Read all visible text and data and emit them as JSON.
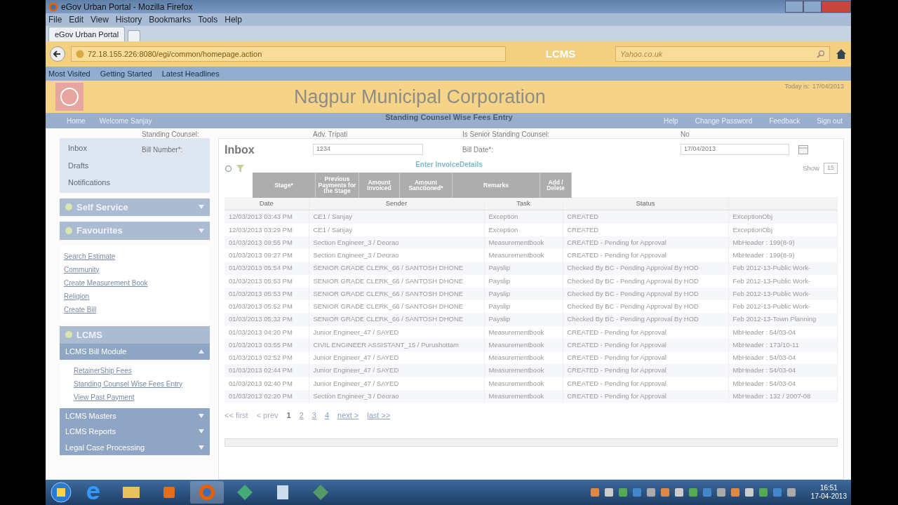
{
  "browser": {
    "title": "eGov Urban Portal - Mozilla Firefox",
    "menu": [
      "File",
      "Edit",
      "View",
      "History",
      "Bookmarks",
      "Tools",
      "Help"
    ],
    "tab": "eGov Urban Portal",
    "url": "72.18.155.226:8080/egi/common/homepage.action",
    "search_placeholder": "Yahoo.co.uk",
    "bookmarks": [
      "Most Visited",
      "Getting Started",
      "Latest Headlines"
    ]
  },
  "header": {
    "title": "Nagpur Municipal Corporation",
    "today_label": "Today is:",
    "today": "17/04/2013"
  },
  "nav": {
    "left": [
      "Home",
      "Welcome  Sanjay"
    ],
    "right": [
      "Help",
      "Change Password",
      "Feedback",
      "Sign out"
    ]
  },
  "sidebar": {
    "mailbox": [
      "Inbox",
      "Drafts",
      "Notifications"
    ],
    "menus": [
      {
        "title": "Self Service"
      },
      {
        "title": "Favourites",
        "links": [
          "Search Estimate",
          "Community",
          "Create Measurement Book",
          "Religion",
          "Create Bill"
        ]
      },
      {
        "title": "LCMS",
        "submenus": [
          {
            "title": "LCMS Bill Module",
            "expanded": true,
            "links": [
              "RetainerShip Fees",
              "Standing Counsel Wise Fees Entry",
              "View Past Payment"
            ]
          },
          {
            "title": "LCMS Masters",
            "expanded": false
          },
          {
            "title": "LCMS Reports",
            "expanded": false
          },
          {
            "title": "Legal Case Processing",
            "expanded": false
          }
        ]
      }
    ]
  },
  "inbox": {
    "title": "Inbox",
    "show_label": "Show",
    "show_value": "15",
    "columns": [
      "Date",
      "Sender",
      "Task",
      "Status"
    ],
    "rows": [
      [
        "12/03/2013 03:43 PM",
        "CE1 / Sanjay",
        "Exception",
        "CREATED",
        "ExceptionObj"
      ],
      [
        "12/03/2013 03:29 PM",
        "CE1 / Sanjay",
        "Exception",
        "CREATED",
        "ExceptionObj"
      ],
      [
        "01/03/2013 09:55 PM",
        "Section Engineer_3 / Deorao",
        "Measurementbook",
        "CREATED - Pending for Approval",
        "MbHeader : 199(8-9)"
      ],
      [
        "01/03/2013 09:27 PM",
        "Section Engineer_3 / Deorao",
        "Measurementbook",
        "CREATED - Pending for Approval",
        "MbHeader : 199(8-9)"
      ],
      [
        "01/03/2013 05:54 PM",
        "SENIOR GRADE CLERK_66 / SANTOSH DHONE",
        "Payslip",
        "Checked By BC - Pending Approval By HOD",
        "Feb 2012-13-Public Work-"
      ],
      [
        "01/03/2013 05:53 PM",
        "SENIOR GRADE CLERK_66 / SANTOSH DHONE",
        "Payslip",
        "Checked By BC - Pending Approval By HOD",
        "Feb 2012-13-Public Work-"
      ],
      [
        "01/03/2013 05:53 PM",
        "SENIOR GRADE CLERK_66 / SANTOSH DHONE",
        "Payslip",
        "Checked By BC - Pending Approval By HOD",
        "Feb 2012-13-Public Work-"
      ],
      [
        "01/03/2013 05:52 PM",
        "SENIOR GRADE CLERK_66 / SANTOSH DHONE",
        "Payslip",
        "Checked By BC - Pending Approval By HOD",
        "Feb 2012-13-Public Work-"
      ],
      [
        "01/03/2013 05:32 PM",
        "SENIOR GRADE CLERK_66 / SANTOSH DHONE",
        "Payslip",
        "Checked By BC - Pending Approval By HOD",
        "Feb 2012-13-Town Planning"
      ],
      [
        "01/03/2013 04:20 PM",
        "Junior Engineer_47 / SAYED",
        "Measurementbook",
        "CREATED - Pending for Approval",
        "MbHeader : 54/03-04"
      ],
      [
        "01/03/2013 03:55 PM",
        "CIVIL ENGINEER ASSISTANT_15 / Purushottam",
        "Measurementbook",
        "CREATED - Pending for Approval",
        "MbHeader : 173/10-11"
      ],
      [
        "01/03/2013 02:52 PM",
        "Junior Engineer_47 / SAYED",
        "Measurementbook",
        "CREATED - Pending for Approval",
        "MbHeader : 54/03-04"
      ],
      [
        "01/03/2013 02:44 PM",
        "Junior Engineer_47 / SAYED",
        "Measurementbook",
        "CREATED - Pending for Approval",
        "MbHeader : 54/03-04"
      ],
      [
        "01/03/2013 02:40 PM",
        "Junior Engineer_47 / SAYED",
        "Measurementbook",
        "CREATED - Pending for Approval",
        "MbHeader : 54/03-04"
      ],
      [
        "01/03/2013 02:20 PM",
        "Section Engineer_3 / Deorao",
        "Measurementbook",
        "CREATED - Pending for Approval",
        "MbHeader : 132 / 2007-08"
      ]
    ],
    "pagination": {
      "first": "<< first",
      "prev": "< prev",
      "pages": [
        {
          "label": "1",
          "selected": true
        },
        {
          "label": "2",
          "selected": false
        },
        {
          "label": "3",
          "selected": false
        },
        {
          "label": "4",
          "selected": false
        }
      ],
      "next": "next >",
      "last": "last >>"
    }
  },
  "overlay": {
    "app_title": "LCMS",
    "form_title": "Standing Counsel Wise Fees Entry",
    "counsel_label": "Standing Counsel:",
    "counsel_value": "Adv. Tripati",
    "senior_label": "Is Senior Standing Counsel:",
    "senior_value": "No",
    "bill_number_label": "Bill Number*:",
    "bill_number": "1234",
    "bill_date_label": "Bill Date*:",
    "bill_date": "17/04/2013",
    "invoice_title": "Enter InvoiceDetails",
    "invoice_columns": [
      "Stage*",
      "Previous Payments for the Stage",
      "Amount Invoiced",
      "Amount Sanctioned*",
      "Remarks",
      "Add / Delete"
    ]
  },
  "taskbar": {
    "time": "16:51",
    "date": "17-04-2013"
  }
}
